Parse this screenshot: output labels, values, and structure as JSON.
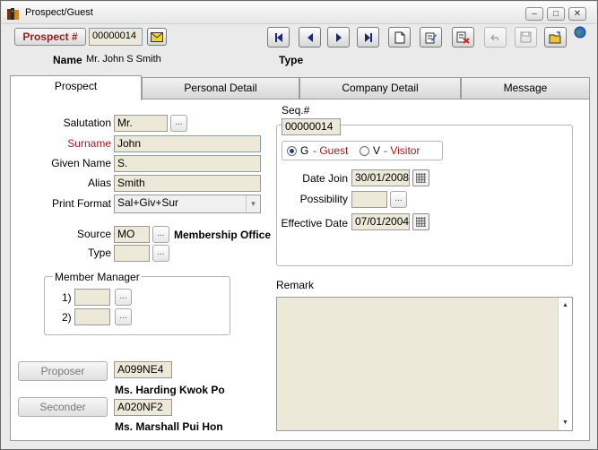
{
  "window": {
    "title": "Prospect/Guest"
  },
  "toolbar": {
    "prospect_button": "Prospect #",
    "prospect_number": "00000014",
    "name_label": "Name",
    "name_value": "Mr. John S Smith",
    "type_label": "Type"
  },
  "tabs": [
    "Prospect",
    "Personal Detail",
    "Company Detail",
    "Message"
  ],
  "form": {
    "salutation_label": "Salutation",
    "salutation": "Mr.",
    "surname_label": "Surname",
    "surname": "John",
    "given_name_label": "Given Name",
    "given_name": "S.",
    "alias_label": "Alias",
    "alias": "Smith",
    "print_format_label": "Print Format",
    "print_format": "Sal+Giv+Sur",
    "source_label": "Source",
    "source": "MO",
    "source_desc": "Membership Office",
    "type_label": "Type",
    "type": "",
    "member_manager_label": "Member Manager",
    "mm1_label": "1)",
    "mm2_label": "2)",
    "proposer_button": "Proposer",
    "proposer_code": "A099NE4",
    "proposer_name": "Ms. Harding Kwok Po",
    "seconder_button": "Seconder",
    "seconder_code": "A020NF2",
    "seconder_name": "Ms. Marshall Pui Hon",
    "seq_label": "Seq.#",
    "seq": "00000014",
    "radio_g": "G",
    "radio_g_desc": "- Guest",
    "radio_g_selected": true,
    "radio_v": "V",
    "radio_v_desc": "- Visitor",
    "date_join_label": "Date Join",
    "date_join": "30/01/2008",
    "possibility_label": "Possibility",
    "possibility": "",
    "effective_date_label": "Effective Date",
    "effective_date": "07/01/2004",
    "remark_label": "Remark"
  },
  "colors": {
    "accent_red": "#9b1b1b",
    "field_bg": "#ece9d8",
    "radio_selected": "#1e3f8a"
  }
}
